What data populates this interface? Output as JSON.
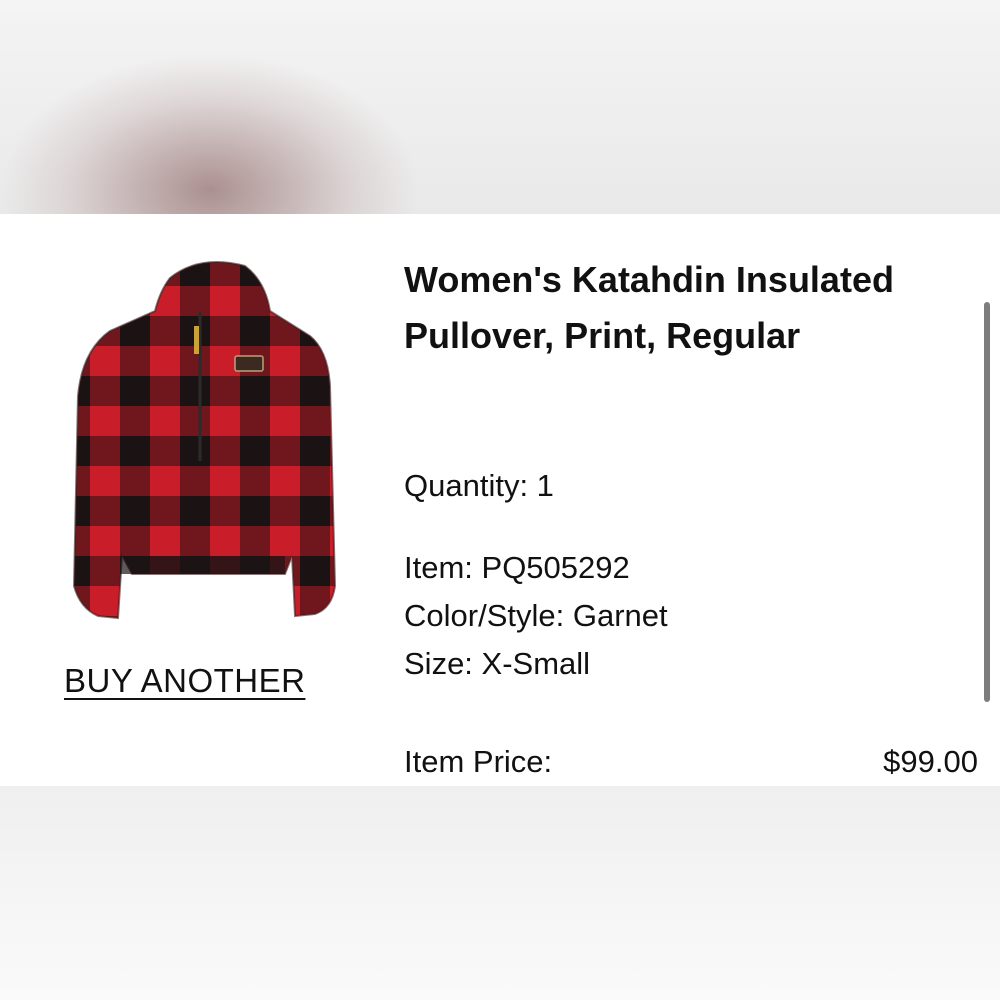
{
  "product": {
    "title": "Women's Katahdin Insulated Pullover, Print, Regular",
    "image_icon": "plaid-pullover-jacket-image",
    "colors": {
      "red": "#d41f2c",
      "black": "#1d1416"
    }
  },
  "actions": {
    "buy_another_label": "BUY ANOTHER"
  },
  "details": {
    "quantity": "Quantity: 1",
    "item": "Item: PQ505292",
    "color_style": "Color/Style: Garnet",
    "size": "Size: X-Small"
  },
  "price": {
    "label": "Item Price:",
    "value": "$99.00"
  }
}
